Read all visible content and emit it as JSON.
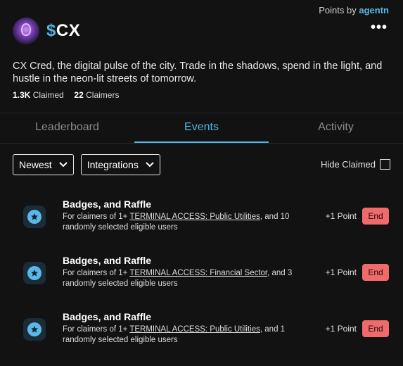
{
  "header": {
    "points_by_prefix": "Points by",
    "points_by_brand": "agentn",
    "ticker_symbol": "$",
    "ticker_name": "CX",
    "more_icon": "more-horizontal-icon"
  },
  "description": "CX Cred, the digital pulse of the city. Trade in the shadows, spend in the light, and hustle in the neon-lit streets of tomorrow.",
  "stats": {
    "claimed_value": "1.3K",
    "claimed_label": "Claimed",
    "claimers_value": "22",
    "claimers_label": "Claimers"
  },
  "tabs": [
    {
      "label": "Leaderboard",
      "active": false
    },
    {
      "label": "Events",
      "active": true
    },
    {
      "label": "Activity",
      "active": false
    }
  ],
  "filters": {
    "sort_label": "Newest",
    "integrations_label": "Integrations",
    "hide_claimed_label": "Hide Claimed",
    "hide_claimed_checked": false
  },
  "events": [
    {
      "title": "Badges, and Raffle",
      "desc_prefix": "For claimers of 1+ ",
      "desc_link": "TERMINAL ACCESS: Public Utilities",
      "desc_suffix": ", and 10 randomly selected eligible users",
      "points": "+1 Point",
      "status": "End"
    },
    {
      "title": "Badges, and Raffle",
      "desc_prefix": "For claimers of 1+ ",
      "desc_link": "TERMINAL ACCESS: Financial Sector",
      "desc_suffix": ", and 3 randomly selected eligible users",
      "points": "+1 Point",
      "status": "End"
    },
    {
      "title": "Badges, and Raffle",
      "desc_prefix": "For claimers of 1+ ",
      "desc_link": "TERMINAL ACCESS: Public Utilities",
      "desc_suffix": ", and 1 randomly selected eligible users",
      "points": "+1 Point",
      "status": "End"
    }
  ],
  "colors": {
    "background": "#121212",
    "accent": "#4fb6e6",
    "end_button": "#f06a6a"
  }
}
